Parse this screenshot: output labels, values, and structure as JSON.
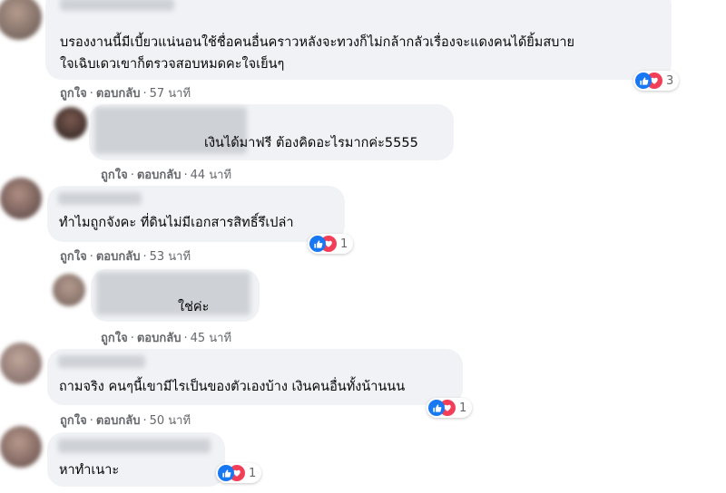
{
  "comments": [
    {
      "text": [
        "บรองงานนี้มีเบี้ยวแน่นอนใช้ชื่อคนอื่นคราวหลังจะทวงก็ไม่กล้ากลัวเรื่องจะแดงคนได้ยิ้มสบาย",
        "ใจเฉิบเดวเขาก็ตรวจสอบหมดคะใจเย็นๆ"
      ],
      "like": "ถูกใจ",
      "reply": "ตอบกลับ",
      "time": "57 นาที",
      "reactions": "3"
    },
    {
      "text": [
        "เงินได้มาฟรี ต้องคิดอะไรมากค่ะ5555"
      ],
      "like": "ถูกใจ",
      "reply": "ตอบกลับ",
      "time": "44 นาที"
    },
    {
      "text": [
        "ทำไมถูกจังคะ ที่ดินไม่มีเอกสารสิทธิ์รึเปล่า"
      ],
      "like": "ถูกใจ",
      "reply": "ตอบกลับ",
      "time": "53 นาที",
      "reactions": "1"
    },
    {
      "text": [
        "ใช่ค่ะ"
      ],
      "like": "ถูกใจ",
      "reply": "ตอบกลับ",
      "time": "45 นาที"
    },
    {
      "text": [
        "ถามจริง คนๆนี้เขามีไรเป็นของตัวเองบ้าง เงินคนอื่นทั้งน้านนน"
      ],
      "like": "ถูกใจ",
      "reply": "ตอบกลับ",
      "time": "50 นาที",
      "reactions": "1"
    },
    {
      "text": [
        "หาทำเนาะ"
      ],
      "reactions": "1"
    }
  ],
  "colors": {
    "bubble": "#f0f2f5",
    "meta": "#65676b",
    "like_blue": "#1877f2",
    "love_red": "#f33e58"
  },
  "icons": {
    "like": "thumbs-up-icon",
    "love": "heart-icon"
  }
}
